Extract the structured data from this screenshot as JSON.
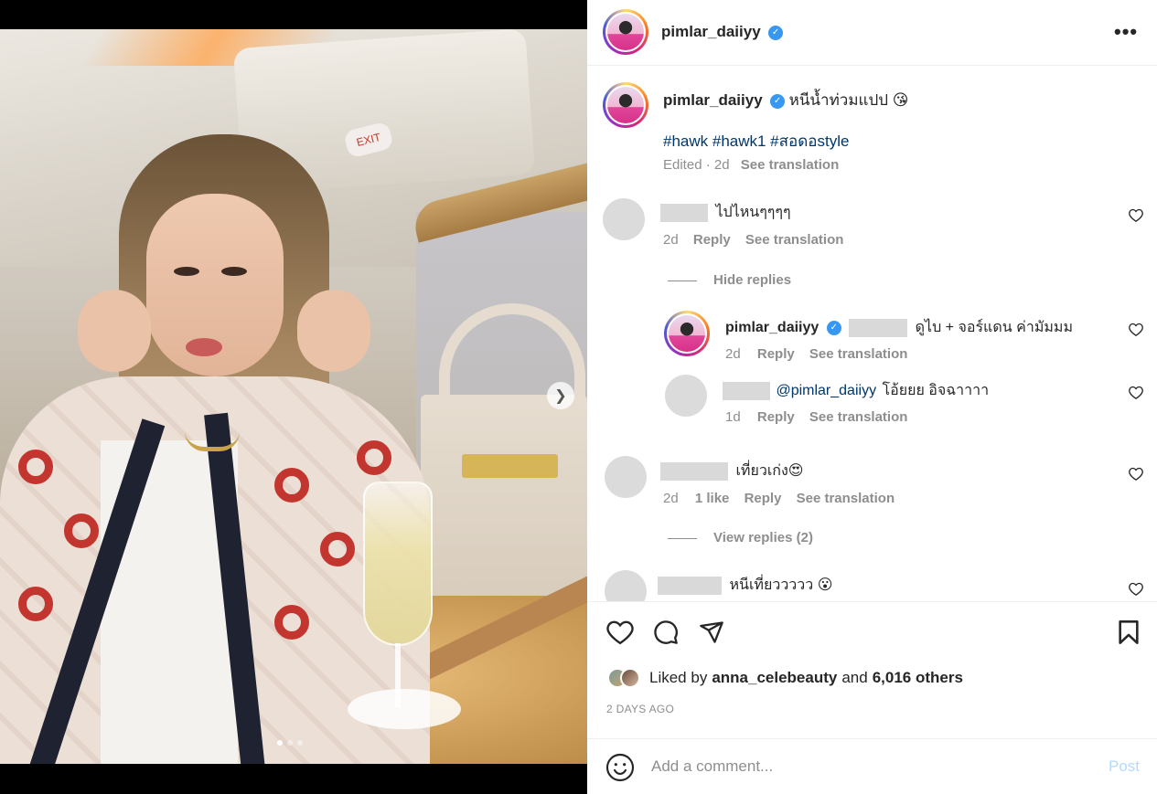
{
  "post": {
    "author": "pimlar_daiiyy",
    "more_label": "•••"
  },
  "caption": {
    "username": "pimlar_daiiyy",
    "text": "หนีน้ำท่วมแปป 😘",
    "hashtags": "#hawk #hawk1 #สอดอstyle",
    "meta_edited": "Edited · 2d",
    "see_translation": "See translation"
  },
  "comments": [
    {
      "text": "ไปไหนๆๆๆๆ",
      "time": "2d",
      "reply": "Reply",
      "see_translation": "See translation",
      "hide_replies": "Hide replies",
      "replies": [
        {
          "username": "pimlar_daiiyy",
          "text": "ดูไบ + จอร์แดน ค่ามัมมม",
          "time": "2d",
          "reply": "Reply",
          "see_translation": "See translation"
        },
        {
          "mention": "@pimlar_daiiyy",
          "text": "โอ้ยยย อิจฉาาาา",
          "time": "1d",
          "reply": "Reply",
          "see_translation": "See translation"
        }
      ]
    },
    {
      "text": "เที่ยวเก่ง😍",
      "time": "2d",
      "likes": "1 like",
      "reply": "Reply",
      "see_translation": "See translation",
      "view_replies": "View replies (2)"
    },
    {
      "text": "หนีเที่ยววววว 😮"
    }
  ],
  "actions": {
    "liked_prefix": "Liked by",
    "liked_user": "anna_celebeauty",
    "liked_and": "and",
    "liked_count": "6,016 others",
    "time_ago": "2 DAYS AGO"
  },
  "add_comment": {
    "placeholder": "Add a comment...",
    "post_label": "Post"
  },
  "media": {
    "exit_sign": "EXIT",
    "carousel_total": 3,
    "carousel_active": 1
  },
  "colors": {
    "link": "#00376b",
    "verified": "#3897f0",
    "post_disabled": "#b3dbff",
    "secondary": "#8e8e8e"
  }
}
